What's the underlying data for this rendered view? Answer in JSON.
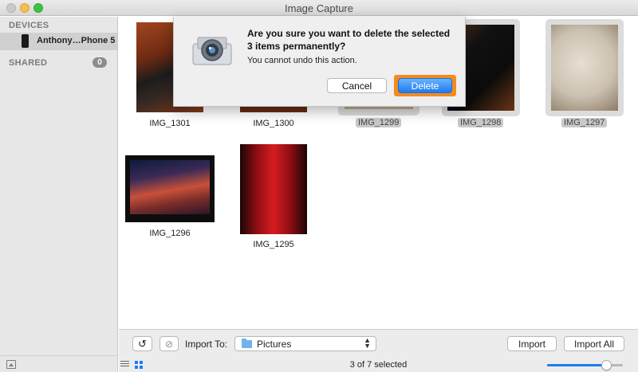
{
  "window": {
    "title": "Image Capture"
  },
  "sidebar": {
    "devices_label": "DEVICES",
    "device_name": "Anthony…Phone 5",
    "shared_label": "SHARED",
    "shared_count": "0"
  },
  "photos": [
    {
      "name": "IMG_1301",
      "selected": false
    },
    {
      "name": "IMG_1300",
      "selected": false
    },
    {
      "name": "IMG_1299",
      "selected": true
    },
    {
      "name": "IMG_1298",
      "selected": true
    },
    {
      "name": "IMG_1297",
      "selected": true
    },
    {
      "name": "IMG_1296",
      "selected": false
    },
    {
      "name": "IMG_1295",
      "selected": false
    }
  ],
  "dialog": {
    "title": "Are you sure you want to delete the selected 3 items permanently?",
    "message": "You cannot undo this action.",
    "cancel_label": "Cancel",
    "delete_label": "Delete"
  },
  "toolbar": {
    "import_to_label": "Import To:",
    "destination": "Pictures",
    "import_label": "Import",
    "import_all_label": "Import All",
    "status": "3 of 7 selected",
    "thumbnail_size_fraction": 0.78
  },
  "colors": {
    "accent": "#1e7cf3",
    "focus_ring": "#f58a1f",
    "selection": "#c9c9c9"
  }
}
